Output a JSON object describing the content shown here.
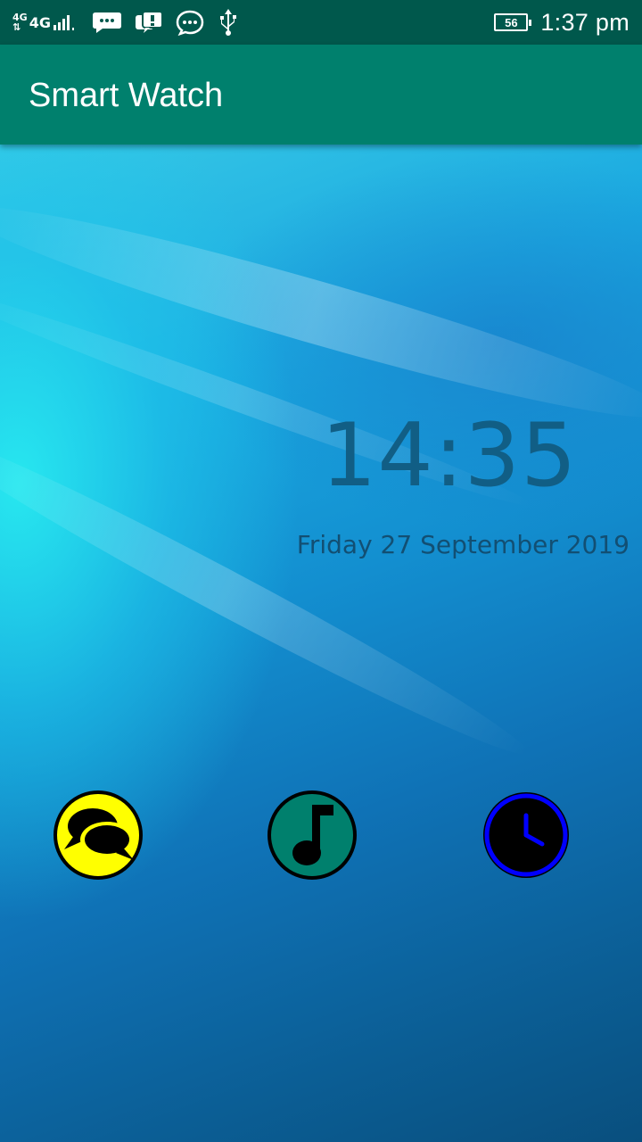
{
  "status_bar": {
    "network_top": "4G",
    "network_main": "4G",
    "battery_level": "56",
    "time": "1:37 pm",
    "icons": [
      "signal-icon",
      "message-icon",
      "chat-notification-icon",
      "chat-bubble-icon",
      "usb-icon",
      "battery-icon"
    ]
  },
  "app_bar": {
    "title": "Smart Watch"
  },
  "watch_face": {
    "time": "14:35",
    "date": "Friday 27 September 2019"
  },
  "apps": [
    {
      "name": "messages-icon",
      "color": "#ffff00"
    },
    {
      "name": "music-icon",
      "color": "#00806d"
    },
    {
      "name": "clock-icon",
      "color": "#0000ff"
    }
  ],
  "colors": {
    "status_bar": "#00584c",
    "app_bar": "#00806d",
    "time_text": "#115e85",
    "date_text": "#124f73"
  }
}
